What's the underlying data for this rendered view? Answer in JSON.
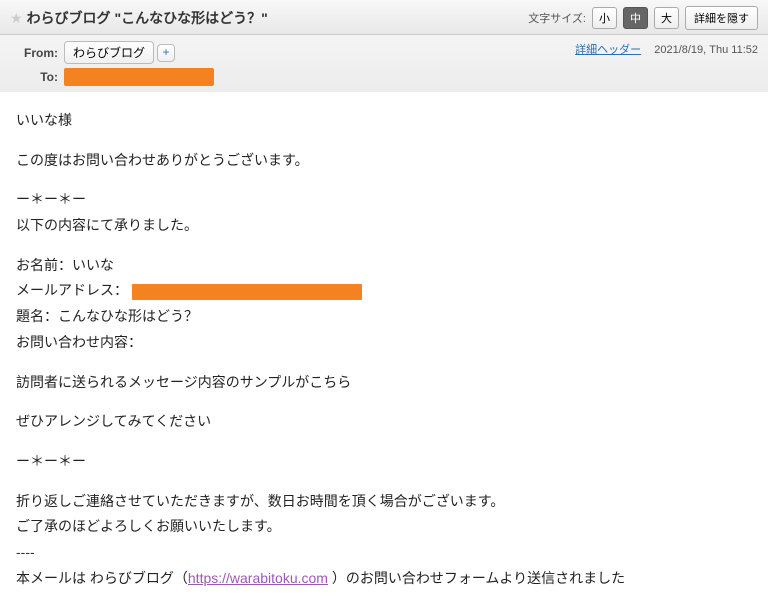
{
  "header": {
    "star": "★",
    "subject": "わらびブログ \"こんなひな形はどう？\"",
    "font_size_label": "文字サイズ:",
    "font_small": "小",
    "font_medium": "中",
    "font_large": "大",
    "detail_toggle": "詳細を隠す"
  },
  "meta": {
    "from_label": "From:",
    "from_name": "わらびブログ",
    "add_symbol": "+",
    "to_label": "To:",
    "detail_header_link": "詳細ヘッダー",
    "date": "2021/8/19, Thu 11:52"
  },
  "body": {
    "greeting": "いいな様",
    "thanks": "この度はお問い合わせありがとうございます。",
    "sep1": "ー＊ー＊ー",
    "received": "以下の内容にて承りました。",
    "name_line": "お名前：いいな",
    "email_label": "メールアドレス：",
    "subject_line": "題名：こんなひな形はどう？",
    "inquiry_label": "お問い合わせ内容：",
    "sample_line": "訪問者に送られるメッセージ内容のサンプルがこちら",
    "arrange_line": "ぜひアレンジしてみてください",
    "sep2": "ー＊ー＊ー",
    "reply_line": "折り返しご連絡させていただきますが、数日お時間を頂く場合がございます。",
    "approve_line": "ご了承のほどよろしくお願いいたします。",
    "dashes": "----",
    "footer_prefix": "本メールは わらびブログ（",
    "footer_url": "https://warabitoku.com",
    "footer_suffix": " ）のお問い合わせフォームより送信されました"
  }
}
